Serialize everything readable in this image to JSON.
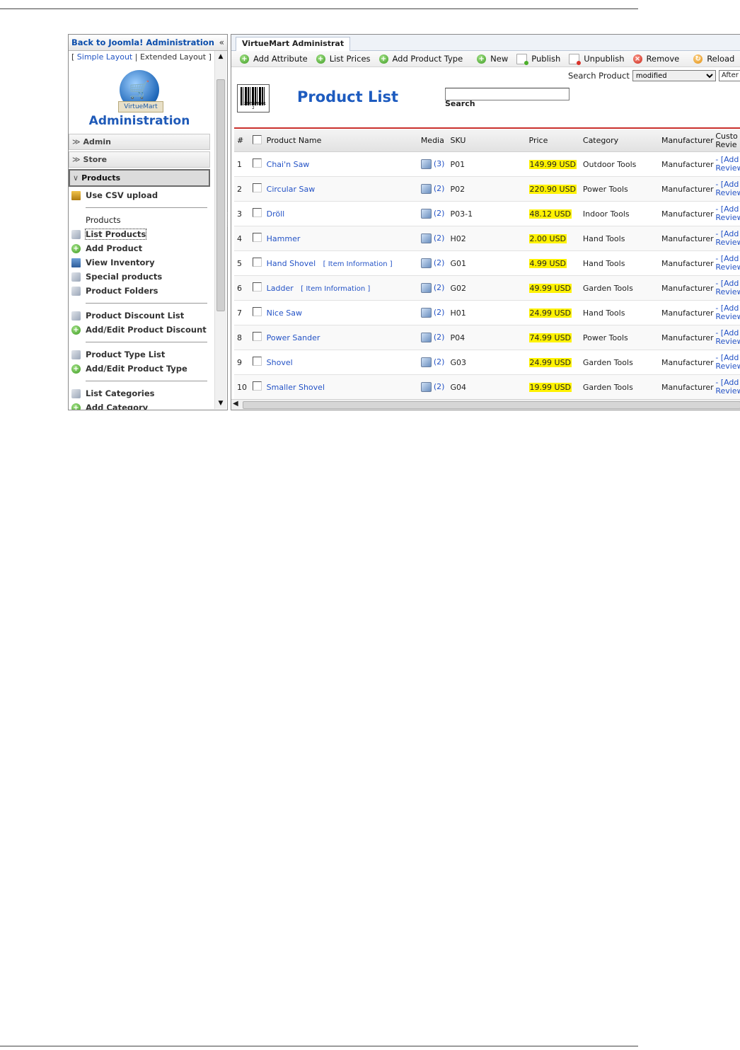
{
  "sidebar": {
    "back_link": "Back to Joomla! Administration",
    "collapse_glyph": "«",
    "layout_prefix": "[ ",
    "simple_layout": "Simple Layout",
    "separator": " | ",
    "extended_layout": "Extended Layout",
    "layout_suffix": " ]",
    "logo_banner": "VirtueMart",
    "logo_title": "Administration",
    "sections": {
      "admin": "Admin",
      "store": "Store",
      "products": "Products"
    },
    "items": {
      "csv_upload": "Use CSV upload",
      "products_heading": "Products",
      "list_products": "List Products",
      "add_product": "Add Product",
      "view_inventory": "View Inventory",
      "special_products": "Special products",
      "product_folders": "Product Folders",
      "product_discount_list": "Product Discount List",
      "add_edit_product_discount": "Add/Edit Product Discount",
      "product_type_list": "Product Type List",
      "add_edit_product_type": "Add/Edit Product Type",
      "list_categories": "List Categories",
      "add_category": "Add Category"
    }
  },
  "main": {
    "tab_label": "VirtueMart Administrat",
    "toolbar": {
      "add_attribute": "Add Attribute",
      "list_prices": "List Prices",
      "add_product_type": "Add Product Type",
      "new": "New",
      "publish": "Publish",
      "unpublish": "Unpublish",
      "remove": "Remove",
      "reload": "Reload"
    },
    "search_product_label": "Search Product",
    "search_filter_value": "modified",
    "search_after_value": "After",
    "page_title": "Product List",
    "barcode_digits": "1 2345678901 2",
    "search_input_value": "",
    "search_button": "Search",
    "columns": {
      "num": "#",
      "product_name": "Product Name",
      "media": "Media",
      "sku": "SKU",
      "price": "Price",
      "category": "Category",
      "manufacturer": "Manufacturer",
      "reviews": "Custo Revie"
    },
    "products": [
      {
        "num": "1",
        "name": "Chai'n Saw",
        "info": "",
        "media": "(3)",
        "sku": "P01",
        "price": "149.99 USD",
        "category": "Outdoor Tools",
        "manufacturer": "Manufacturer",
        "review": "- [Add Review"
      },
      {
        "num": "2",
        "name": "Circular Saw",
        "info": "",
        "media": "(2)",
        "sku": "P02",
        "price": "220.90 USD",
        "category": "Power Tools",
        "manufacturer": "Manufacturer",
        "review": "- [Add Review"
      },
      {
        "num": "3",
        "name": "Dröll",
        "info": "",
        "media": "(2)",
        "sku": "P03-1",
        "price": "48.12 USD",
        "category": "Indoor Tools",
        "manufacturer": "Manufacturer",
        "review": "- [Add Review"
      },
      {
        "num": "4",
        "name": "Hammer",
        "info": "",
        "media": "(2)",
        "sku": "H02",
        "price": "2.00 USD",
        "category": "Hand Tools",
        "manufacturer": "Manufacturer",
        "review": "- [Add Review"
      },
      {
        "num": "5",
        "name": "Hand Shovel",
        "info": "[ Item Information ]",
        "media": "(2)",
        "sku": "G01",
        "price": "4.99 USD",
        "category": "Hand Tools",
        "manufacturer": "Manufacturer",
        "review": "- [Add Review"
      },
      {
        "num": "6",
        "name": "Ladder",
        "info": "[ Item Information ]",
        "media": "(2)",
        "sku": "G02",
        "price": "49.99 USD",
        "category": "Garden Tools",
        "manufacturer": "Manufacturer",
        "review": "- [Add Review"
      },
      {
        "num": "7",
        "name": "Nice Saw",
        "info": "",
        "media": "(2)",
        "sku": "H01",
        "price": "24.99 USD",
        "category": "Hand Tools",
        "manufacturer": "Manufacturer",
        "review": "- [Add Review"
      },
      {
        "num": "8",
        "name": "Power Sander",
        "info": "",
        "media": "(2)",
        "sku": "P04",
        "price": "74.99 USD",
        "category": "Power Tools",
        "manufacturer": "Manufacturer",
        "review": "- [Add Review"
      },
      {
        "num": "9",
        "name": "Shovel",
        "info": "",
        "media": "(2)",
        "sku": "G03",
        "price": "24.99 USD",
        "category": "Garden Tools",
        "manufacturer": "Manufacturer",
        "review": "- [Add Review"
      },
      {
        "num": "10",
        "name": "Smaller Shovel",
        "info": "",
        "media": "(2)",
        "sku": "G04",
        "price": "19.99 USD",
        "category": "Garden Tools",
        "manufacturer": "Manufacturer",
        "review": "- [Add Review"
      }
    ]
  },
  "colors": {
    "link": "#2453c6",
    "title_blue": "#1d5bbf",
    "price_highlight": "#fff200",
    "header_rule": "#c9302c"
  }
}
